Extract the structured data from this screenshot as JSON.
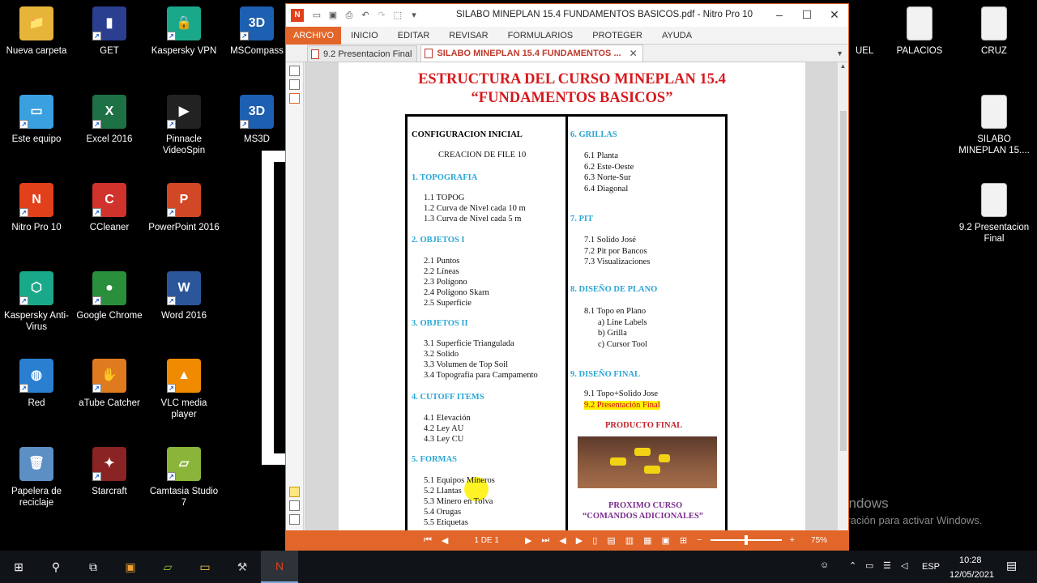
{
  "desktop": {
    "icons": [
      {
        "label": "Nueva carpeta",
        "glyph": "📁",
        "color": "#e7b43a"
      },
      {
        "label": "GET",
        "glyph": "▮",
        "color": "#2a3f8f"
      },
      {
        "label": "Kaspersky VPN",
        "glyph": "🔒",
        "color": "#1aa88a"
      },
      {
        "label": "MSCompass",
        "glyph": "3D",
        "color": "#1d5fb0"
      },
      {
        "label": "Este equipo",
        "glyph": "▭",
        "color": "#3aa0e0"
      },
      {
        "label": "Excel 2016",
        "glyph": "X",
        "color": "#1e7145"
      },
      {
        "label": "Pinnacle VideoSpin",
        "glyph": "▶",
        "color": "#222"
      },
      {
        "label": "MS3D",
        "glyph": "3D",
        "color": "#1d5fb0"
      },
      {
        "label": "Nitro Pro 10",
        "glyph": "N",
        "color": "#e2401b"
      },
      {
        "label": "CCleaner",
        "glyph": "C",
        "color": "#d0332b"
      },
      {
        "label": "PowerPoint 2016",
        "glyph": "P",
        "color": "#d24726"
      },
      {
        "label": "Kaspersky Anti-Virus",
        "glyph": "⬡",
        "color": "#1aa88a"
      },
      {
        "label": "Google Chrome",
        "glyph": "●",
        "color": "#2a8f3c"
      },
      {
        "label": "Word 2016",
        "glyph": "W",
        "color": "#2b579a"
      },
      {
        "label": "Red",
        "glyph": "◍",
        "color": "#2b7fd0"
      },
      {
        "label": "aTube Catcher",
        "glyph": "✋",
        "color": "#e07a1f"
      },
      {
        "label": "VLC media player",
        "glyph": "▲",
        "color": "#f08a00"
      },
      {
        "label": "Papelera de reciclaje",
        "glyph": "🗑",
        "color": "#5c8fc4"
      },
      {
        "label": "Starcraft",
        "glyph": "✦",
        "color": "#8a2323"
      },
      {
        "label": "Camtasia Studio 7",
        "glyph": "▱",
        "color": "#8ab43a"
      },
      {
        "label": "UEL",
        "glyph": "",
        "color": "#fff"
      },
      {
        "label": "PALACIOS",
        "glyph": "",
        "color": "#f2f2f2"
      },
      {
        "label": "CRUZ",
        "glyph": "",
        "color": "#f2f2f2"
      },
      {
        "label": "SILABO MINEPLAN 15....",
        "glyph": "",
        "color": "#f2f2f2"
      },
      {
        "label": "9.2 Presentacion Final",
        "glyph": "",
        "color": "#f2f2f2"
      }
    ],
    "watermark_title": "Activar Windows",
    "watermark_sub": "Ve a Configuración para activar Windows."
  },
  "window": {
    "title": "SILABO MINEPLAN 15.4 FUNDAMENTOS BASICOS.pdf - Nitro Pro 10",
    "ribbon_tabs": [
      "ARCHIVO",
      "INICIO",
      "EDITAR",
      "REVISAR",
      "FORMULARIOS",
      "PROTEGER",
      "AYUDA"
    ],
    "doc_tabs": [
      {
        "label": "9.2 Presentacion Final"
      },
      {
        "label": "SILABO MINEPLAN 15.4 FUNDAMENTOS ..."
      }
    ],
    "status": {
      "page_indicator": "1 DE 1",
      "zoom": "75%",
      "zoom_fraction": 0.5
    }
  },
  "doc": {
    "title_line1": "ESTRUCTURA DEL CURSO MINEPLAN 15.4",
    "title_line2": "“FUNDAMENTOS BASICOS”",
    "left": {
      "config_heading": "CONFIGURACION INICIAL",
      "config_item": "CREACION DE FILE 10",
      "s1": {
        "heading": "1.  TOPOGRAFIA",
        "items": [
          "1.1  TOPOG",
          "1.2  Curva de Nivel cada 10 m",
          "1.3  Curva de Nivel cada 5 m"
        ]
      },
      "s2": {
        "heading": "2.  OBJETOS I",
        "items": [
          "2.1  Puntos",
          "2.2  Líneas",
          "2.3  Polígono",
          "2.4  Polígono Skarn",
          "2.5  Superficie"
        ]
      },
      "s3": {
        "heading": "3.  OBJETOS II",
        "items": [
          "3.1  Superficie Triangulada",
          "3.2  Solido",
          "3.3  Volumen de Top Soil",
          "3.4  Topografía para Campamento"
        ]
      },
      "s4": {
        "heading": "4.  CUTOFF ITEMS",
        "items": [
          "4.1  Elevación",
          "4.2  Ley  AU",
          "4.3  Ley  CU"
        ]
      },
      "s5": {
        "heading": "5. FORMAS",
        "items": [
          "5.1  Equipos Mineros",
          "5.2  Llantas",
          "5.3  Minero en Tolva",
          "5.4  Orugas",
          "5.5  Etiquetas"
        ]
      }
    },
    "right": {
      "s6": {
        "heading": "6. GRILLAS",
        "items": [
          "6.1  Planta",
          "6.2  Este-Oeste",
          "6.3  Norte-Sur",
          "6.4   Diagonal"
        ]
      },
      "s7": {
        "heading": "7. PIT",
        "items": [
          "7.1  Solido José",
          "7.2  Pit por Bancos",
          "7.3  Visualizaciones"
        ]
      },
      "s8": {
        "heading": "8. DISEÑO DE PLANO",
        "items": [
          "8.1  Topo en Plano",
          "a)   Line Labels",
          "b)   Grilla",
          "c)   Cursor Tool"
        ]
      },
      "s9": {
        "heading": "9.   DISEÑO FINAL",
        "items": [
          "9.1  Topo+Solido Jose",
          "9.2  Presentación Final"
        ]
      },
      "product_final": "PRODUCTO FINAL",
      "next1": "PROXIMO CURSO",
      "next2": "“COMANDOS ADICIONALES”"
    }
  },
  "taskbar": {
    "lang": "ESP",
    "time": "10:28",
    "date": "12/05/2021"
  }
}
